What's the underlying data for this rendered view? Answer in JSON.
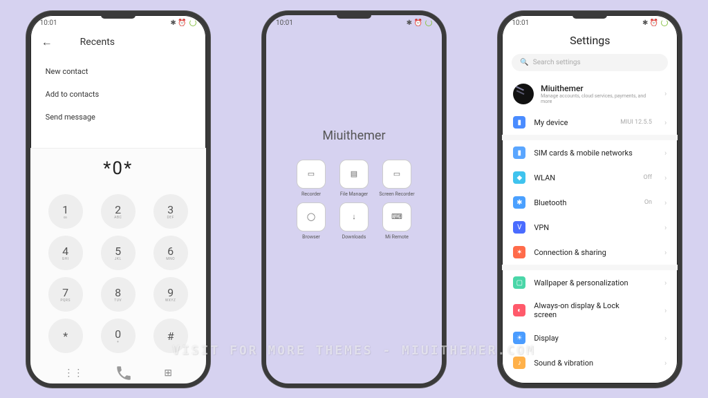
{
  "status": {
    "time": "10:01",
    "icons": "✱ ⏰"
  },
  "phone1": {
    "header_title": "Recents",
    "menu": [
      "New contact",
      "Add to contacts",
      "Send message"
    ],
    "dial_display": "*0*",
    "keys": [
      {
        "n": "1",
        "s": "∞"
      },
      {
        "n": "2",
        "s": "ABC"
      },
      {
        "n": "3",
        "s": "DEF"
      },
      {
        "n": "4",
        "s": "GHI"
      },
      {
        "n": "5",
        "s": "JKL"
      },
      {
        "n": "6",
        "s": "MNO"
      },
      {
        "n": "7",
        "s": "PQRS"
      },
      {
        "n": "8",
        "s": "TUV"
      },
      {
        "n": "9",
        "s": "WXYZ"
      },
      {
        "n": "*",
        "s": ""
      },
      {
        "n": "0",
        "s": "+"
      },
      {
        "n": "#",
        "s": ""
      }
    ]
  },
  "phone2": {
    "folder_title": "Miuithemer",
    "apps": [
      {
        "label": "Recorder",
        "glyph": "▭"
      },
      {
        "label": "File Manager",
        "glyph": "▤"
      },
      {
        "label": "Screen Recorder",
        "glyph": "▭"
      },
      {
        "label": "Browser",
        "glyph": "◯"
      },
      {
        "label": "Downloads",
        "glyph": "↓"
      },
      {
        "label": "Mi Remote",
        "glyph": "⌨"
      }
    ]
  },
  "phone3": {
    "title": "Settings",
    "search_placeholder": "Search settings",
    "profile": {
      "name": "Miuithemer",
      "desc": "Manage accounts, cloud services, payments, and more"
    },
    "my_device": {
      "label": "My device",
      "value": "MIUI 12.5.5"
    },
    "group_net": [
      {
        "label": "SIM cards & mobile networks",
        "value": "",
        "color": "#5aa6ff",
        "glyph": "▮"
      },
      {
        "label": "WLAN",
        "value": "Off",
        "color": "#3fc3ee",
        "glyph": "◆"
      },
      {
        "label": "Bluetooth",
        "value": "On",
        "color": "#4aa0ff",
        "glyph": "✱"
      },
      {
        "label": "VPN",
        "value": "",
        "color": "#4a6cff",
        "glyph": "V"
      },
      {
        "label": "Connection & sharing",
        "value": "",
        "color": "#ff6b4a",
        "glyph": "✶"
      }
    ],
    "group_disp": [
      {
        "label": "Wallpaper & personalization",
        "value": "",
        "color": "#4ad6a8",
        "glyph": "▢"
      },
      {
        "label": "Always-on display & Lock screen",
        "value": "",
        "color": "#ff5a6b",
        "glyph": "◐"
      },
      {
        "label": "Display",
        "value": "",
        "color": "#4a9cff",
        "glyph": "☀"
      },
      {
        "label": "Sound & vibration",
        "value": "",
        "color": "#ffb14a",
        "glyph": "♪"
      }
    ]
  },
  "watermark": "VISIT FOR MORE THEMES - MIUITHEMER.COM"
}
